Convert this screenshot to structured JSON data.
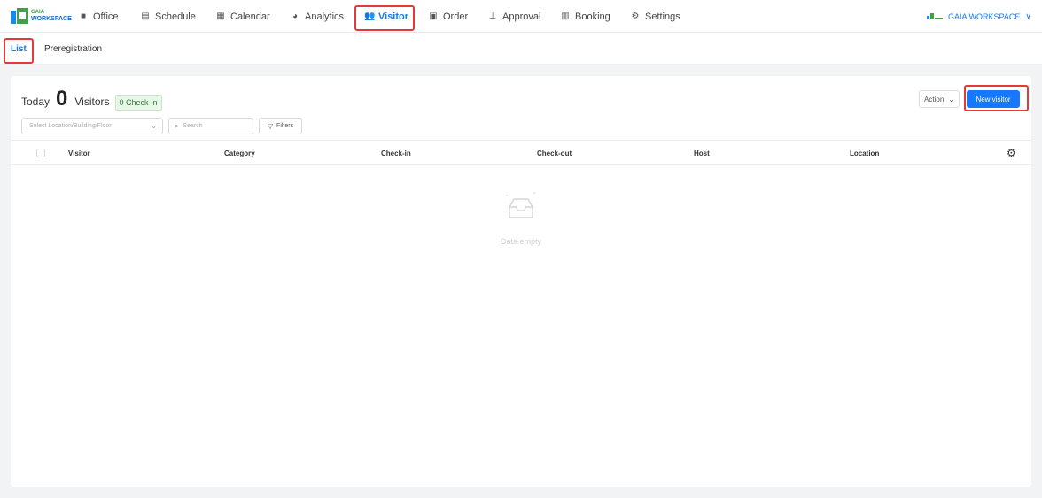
{
  "brand": {
    "line1": "GAIA",
    "line2": "WORKSPACE"
  },
  "nav": {
    "items": [
      {
        "label": "Office",
        "icon": "briefcase-icon"
      },
      {
        "label": "Schedule",
        "icon": "schedule-icon"
      },
      {
        "label": "Calendar",
        "icon": "calendar-icon"
      },
      {
        "label": "Analytics",
        "icon": "pie-chart-icon"
      },
      {
        "label": "Visitor",
        "icon": "users-icon",
        "active": true
      },
      {
        "label": "Order",
        "icon": "order-icon"
      },
      {
        "label": "Approval",
        "icon": "stamp-icon"
      },
      {
        "label": "Booking",
        "icon": "booking-icon"
      },
      {
        "label": "Settings",
        "icon": "gear-icon"
      }
    ],
    "workspace": "GAIA WORKSPACE",
    "workspace_chevron": "∨"
  },
  "subtabs": [
    {
      "label": "List",
      "active": true
    },
    {
      "label": "Preregistration"
    }
  ],
  "summary": {
    "today_label": "Today",
    "count": "0",
    "visitors_label": "Visitors",
    "checkin_badge": "0 Check-in"
  },
  "toolbar": {
    "action_label": "Action",
    "new_visitor_label": "New visitor",
    "location_placeholder": "Select Location/Building/Floor",
    "search_placeholder": "Search",
    "filters_label": "Filters"
  },
  "table": {
    "columns": [
      "Visitor",
      "Category",
      "Check-in",
      "Check-out",
      "Host",
      "Location"
    ],
    "empty_text": "Data empty"
  },
  "colors": {
    "accent": "#1677ff",
    "highlight": "#e53935",
    "badge_green": "#2e7d32"
  }
}
